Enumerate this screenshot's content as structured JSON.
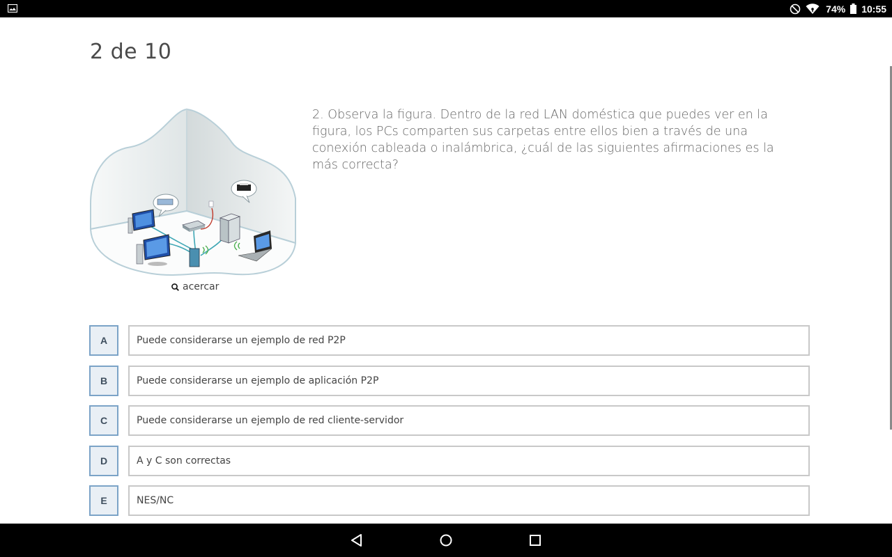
{
  "status_bar": {
    "battery_pct": "74%",
    "time": "10:55",
    "icons": [
      "image-notification-icon",
      "do-not-disturb-icon",
      "wifi-icon",
      "battery-icon"
    ]
  },
  "quiz": {
    "counter": "2 de 10",
    "question": "2. Observa la figura. Dentro de la red LAN doméstica que puedes ver en la figura, los PCs comparten sus carpetas entre ellos bien a través de una conexión cableada o inalámbrica, ¿cuál de las siguientes afirmaciones es la más correcta?",
    "zoom_label": "acercar",
    "options": [
      {
        "letter": "A",
        "text": "Puede considerarse un ejemplo de red P2P"
      },
      {
        "letter": "B",
        "text": "Puede considerarse un ejemplo de aplicación P2P"
      },
      {
        "letter": "C",
        "text": "Puede considerarse un ejemplo de red cliente-servidor"
      },
      {
        "letter": "D",
        "text": "A y C son correctas"
      },
      {
        "letter": "E",
        "text": "NES/NC"
      }
    ]
  },
  "nav_bar": {
    "icons": [
      "back-icon",
      "home-icon",
      "recents-icon"
    ]
  },
  "colors": {
    "letter_border": "#7ba3c7",
    "letter_bg": "#e9eff5",
    "option_border": "#c8c8c8"
  }
}
